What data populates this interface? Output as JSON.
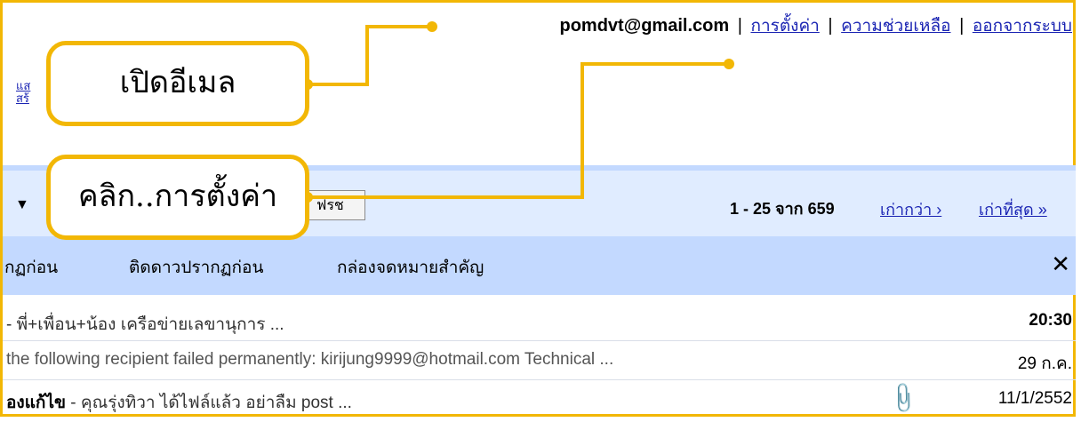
{
  "account": {
    "email": "pomdvt@gmail.com",
    "links": [
      "การตั้งค่า",
      "ความช่วยเหลือ",
      "ออกจากระบบ"
    ],
    "separator": "|"
  },
  "side_links": [
    "แส",
    "สร้"
  ],
  "toolbar": {
    "dropdown_arrow": "▼",
    "search_button_label": "ฟรช",
    "range_text": "1 - 25 จาก 659",
    "older_link": "เก่ากว่า ›",
    "oldest_link": "เก่าที่สุด »"
  },
  "tabs": [
    "กฏก่อน",
    "ติดดาวปรากฏก่อน",
    "กล่องจดหมายสำคัญ"
  ],
  "close_label": "✕",
  "messages": [
    {
      "sender": "",
      "snippet": "- พี่+เพื่อน+น้อง เครือข่ายเลขานุการ ...",
      "date": "20:30",
      "unread": true,
      "attachment": false
    },
    {
      "sender": "",
      "snippet": "the following recipient failed permanently: kirijung9999@hotmail.com Technical ...",
      "date": "29 ก.ค.",
      "unread": false,
      "attachment": false
    },
    {
      "sender": "องแก้ไข",
      "snippet": " - คุณรุ่งทิวา ได้ไฟล์แล้ว อย่าลืม post ...",
      "date": "11/1/2552",
      "unread": false,
      "attachment": true
    }
  ],
  "callouts": {
    "open_email": "เปิดอีเมล",
    "click_settings": "คลิก..การตั้งค่า"
  },
  "colors": {
    "callout_border": "#f2b705",
    "link": "#1a24b3",
    "toolbar_bg": "#e0ecff",
    "tabs_bg": "#c3d9ff"
  }
}
